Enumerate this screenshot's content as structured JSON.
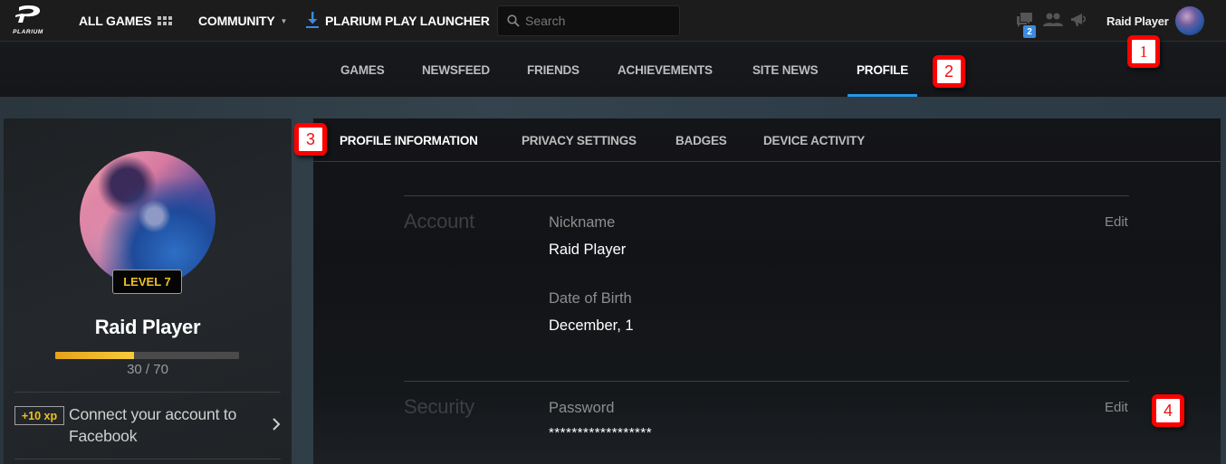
{
  "topbar": {
    "logo_text": "PLARIUM",
    "all_games_label": "ALL GAMES",
    "community_label": "COMMUNITY",
    "launcher_label": "PLARIUM PLAY LAUNCHER",
    "search_placeholder": "Search",
    "search_value": "",
    "messages_count": "2",
    "user_name": "Raid Player",
    "icons": [
      "plarium-logo-icon",
      "grid-icon",
      "caret-down-icon",
      "download-icon",
      "search-icon",
      "chat-icon",
      "friends-icon",
      "megaphone-icon",
      "avatar"
    ]
  },
  "subnav": {
    "items": [
      {
        "label": "GAMES",
        "active": false
      },
      {
        "label": "NEWSFEED",
        "active": false
      },
      {
        "label": "FRIENDS",
        "active": false
      },
      {
        "label": "ACHIEVEMENTS",
        "active": false
      },
      {
        "label": "SITE NEWS",
        "active": false
      },
      {
        "label": "PROFILE",
        "active": true
      }
    ],
    "accent_color": "#2795e6"
  },
  "profile_card": {
    "level_label": "LEVEL 7",
    "player_name": "Raid Player",
    "xp_current": 30,
    "xp_max": 70,
    "xp_text": "30 / 70",
    "xp_fraction": 0.4286,
    "connect_reward": "+10 xp",
    "connect_text": "Connect your account to Facebook",
    "accent_color": "#f0c020"
  },
  "profile_tabs": [
    {
      "label": "PROFILE INFORMATION",
      "active": true
    },
    {
      "label": "PRIVACY SETTINGS",
      "active": false
    },
    {
      "label": "BADGES",
      "active": false
    },
    {
      "label": "DEVICE ACTIVITY",
      "active": false
    }
  ],
  "sections": {
    "account": {
      "title": "Account",
      "edit_label": "Edit",
      "fields": [
        {
          "label": "Nickname",
          "value": "Raid Player"
        },
        {
          "label": "Date of Birth",
          "value": "December, 1"
        }
      ]
    },
    "security": {
      "title": "Security",
      "edit_label": "Edit",
      "fields": [
        {
          "label": "Password",
          "value": "******************"
        }
      ]
    }
  },
  "annotations": [
    "1",
    "2",
    "3",
    "4"
  ]
}
